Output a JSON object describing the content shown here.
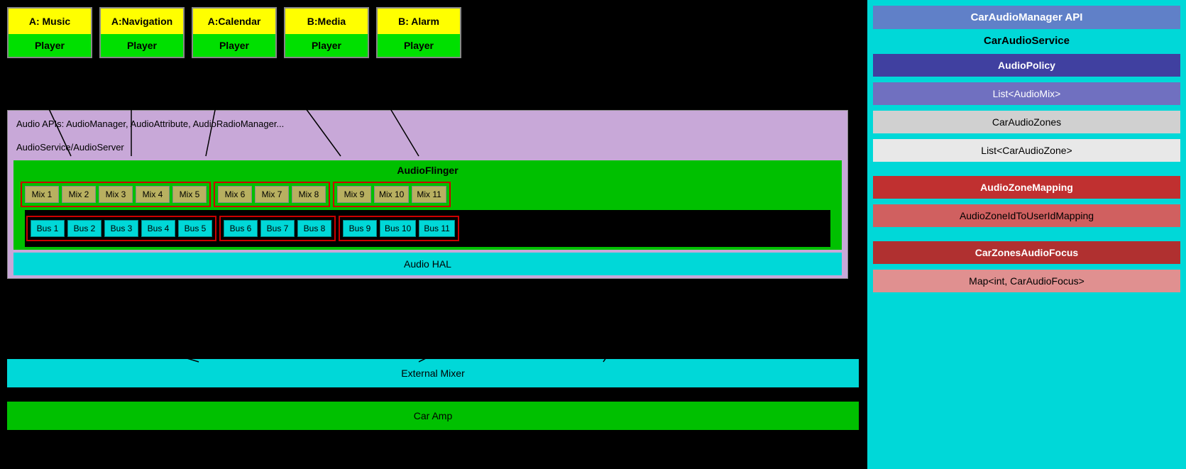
{
  "app_boxes": [
    {
      "label": "A: Music",
      "player": "Player"
    },
    {
      "label": "A:Navigation",
      "player": "Player"
    },
    {
      "label": "A:Calendar",
      "player": "Player"
    },
    {
      "label": "B:Media",
      "player": "Player"
    },
    {
      "label": "B: Alarm",
      "player": "Player"
    }
  ],
  "audio_apis_label": "Audio APIs: AudioManager, AudioAttribute, AudioRadioManager...",
  "audio_service_label": "AudioService/AudioServer",
  "audio_flinger_label": "AudioFlinger",
  "mix_zones": [
    {
      "items": [
        "Mix 1",
        "Mix 2",
        "Mix 3",
        "Mix 4",
        "Mix 5"
      ]
    },
    {
      "items": [
        "Mix 6",
        "Mix 7",
        "Mix 8"
      ]
    },
    {
      "items": [
        "Mix 9",
        "Mix 10",
        "Mix 11"
      ]
    }
  ],
  "bus_zones": [
    {
      "items": [
        "Bus 1",
        "Bus 2",
        "Bus 3",
        "Bus 4",
        "Bus 5"
      ]
    },
    {
      "items": [
        "Bus 6",
        "Bus 7",
        "Bus 8"
      ]
    },
    {
      "items": [
        "Bus 9",
        "Bus 10",
        "Bus 11"
      ]
    }
  ],
  "audio_hal_label": "Audio HAL",
  "external_mixer_label": "External Mixer",
  "car_amp_label": "Car Amp",
  "right_panel": {
    "title": "CarAudioManager API",
    "service_label": "CarAudioService",
    "audio_policy": "AudioPolicy",
    "list_audio_mix": "List<AudioMix>",
    "car_audio_zones": "CarAudioZones",
    "list_car_audio_zone": "List<CarAudioZone>",
    "audio_zone_mapping": "AudioZoneMapping",
    "audio_zone_id_to_user_id_mapping": "AudioZoneIdToUserIdMapping",
    "car_zones_audio_focus": "CarZonesAudioFocus",
    "map_car_audio_focus": "Map<int, CarAudioFocus>"
  }
}
